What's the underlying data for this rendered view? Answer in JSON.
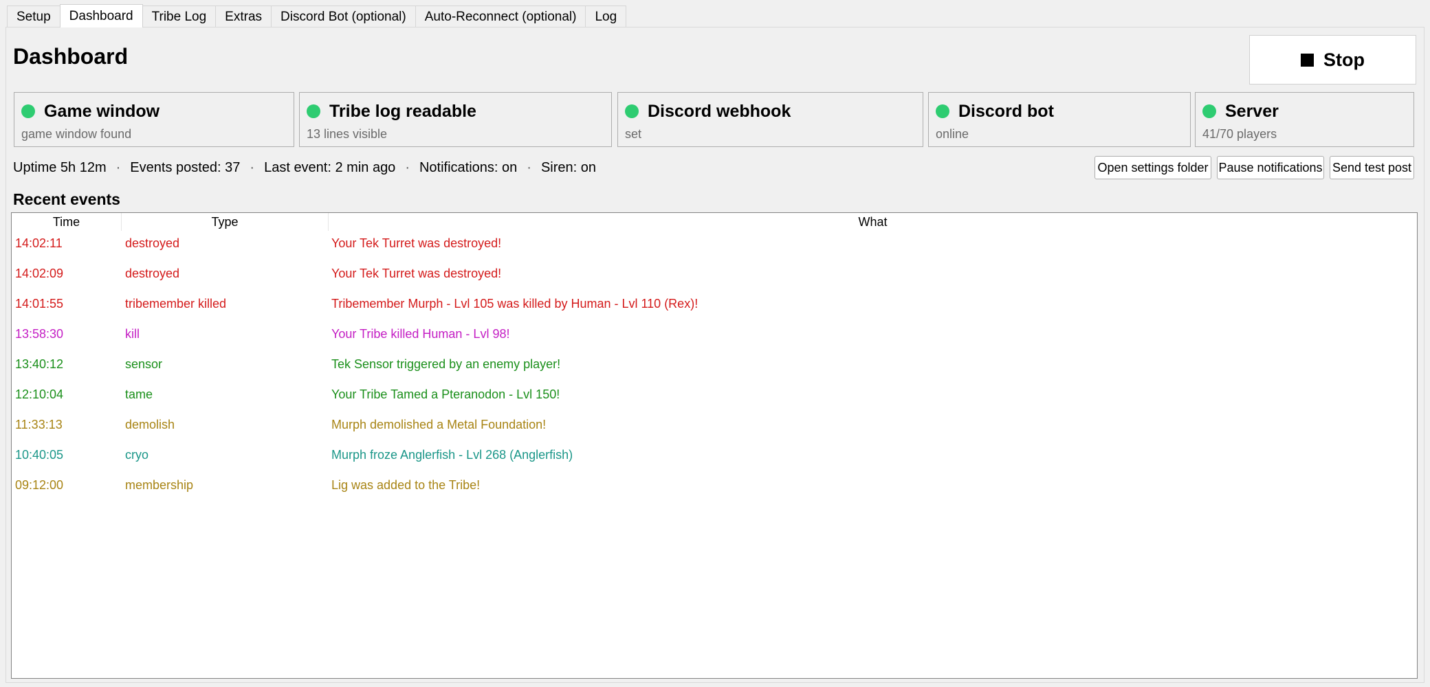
{
  "tabs": [
    {
      "label": "Setup",
      "active": false
    },
    {
      "label": "Dashboard",
      "active": true
    },
    {
      "label": "Tribe Log",
      "active": false
    },
    {
      "label": "Extras",
      "active": false
    },
    {
      "label": "Discord Bot (optional)",
      "active": false
    },
    {
      "label": "Auto-Reconnect (optional)",
      "active": false
    },
    {
      "label": "Log",
      "active": false
    }
  ],
  "header": {
    "title": "Dashboard",
    "stop_label": "Stop"
  },
  "status_cards": [
    {
      "title": "Game window",
      "subtitle": "game window found",
      "status_color": "#2ecc71"
    },
    {
      "title": "Tribe log readable",
      "subtitle": "13 lines visible",
      "status_color": "#2ecc71"
    },
    {
      "title": "Discord webhook",
      "subtitle": "set",
      "status_color": "#2ecc71"
    },
    {
      "title": "Discord bot",
      "subtitle": "online",
      "status_color": "#2ecc71"
    },
    {
      "title": "Server",
      "subtitle": "41/70 players",
      "status_color": "#2ecc71"
    }
  ],
  "status_line": {
    "uptime": "Uptime 5h 12m",
    "events_posted": "Events posted: 37",
    "last_event": "Last event: 2 min ago",
    "notifications": "Notifications: on",
    "siren": "Siren: on",
    "separator": "·"
  },
  "actions": {
    "open_settings": "Open settings folder",
    "pause_notifications": "Pause notifications",
    "send_test": "Send test post"
  },
  "recent_events": {
    "title": "Recent events",
    "columns": [
      "Time",
      "Type",
      "What"
    ],
    "rows": [
      {
        "time": "14:02:11",
        "type": "destroyed",
        "what": "Your Tek Turret was destroyed!",
        "color": "#d41a1a"
      },
      {
        "time": "14:02:09",
        "type": "destroyed",
        "what": "Your Tek Turret was destroyed!",
        "color": "#d41a1a"
      },
      {
        "time": "14:01:55",
        "type": "tribemember killed",
        "what": "Tribemember Murph - Lvl 105 was killed by Human - Lvl 110 (Rex)!",
        "color": "#d41a1a"
      },
      {
        "time": "13:58:30",
        "type": "kill",
        "what": "Your Tribe killed Human - Lvl 98!",
        "color": "#c41ec4"
      },
      {
        "time": "13:40:12",
        "type": "sensor",
        "what": "Tek Sensor triggered by an enemy player!",
        "color": "#1a8f1a"
      },
      {
        "time": "12:10:04",
        "type": "tame",
        "what": "Your Tribe Tamed a Pteranodon - Lvl 150!",
        "color": "#1a8f1a"
      },
      {
        "time": "11:33:13",
        "type": "demolish",
        "what": "Murph demolished a Metal Foundation!",
        "color": "#a88414"
      },
      {
        "time": "10:40:05",
        "type": "cryo",
        "what": "Murph froze Anglerfish - Lvl 268 (Anglerfish)",
        "color": "#1a9688"
      },
      {
        "time": "09:12:00",
        "type": "membership",
        "what": "Lig was added to the Tribe!",
        "color": "#a88414"
      }
    ]
  }
}
